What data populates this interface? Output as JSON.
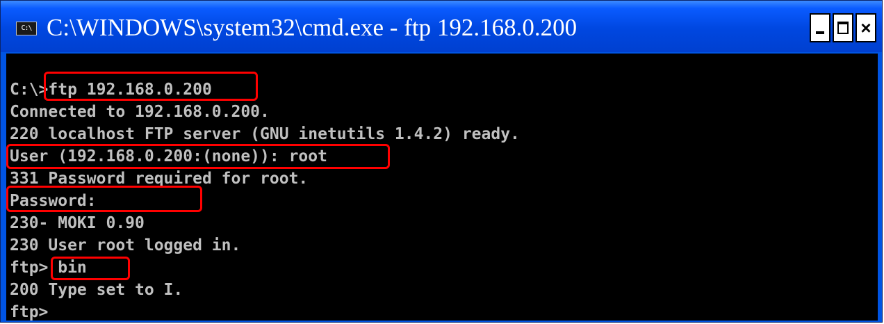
{
  "window": {
    "title": "C:\\WINDOWS\\system32\\cmd.exe - ftp 192.168.0.200",
    "icon": "cmd-console-icon",
    "icon_text": "C:\\",
    "controls": [
      "minimize-icon",
      "maximize-icon",
      "close-icon"
    ],
    "close_label": "×"
  },
  "console": {
    "lines": [
      "C:\\>ftp 192.168.0.200",
      "Connected to 192.168.0.200.",
      "220 localhost FTP server (GNU inetutils 1.4.2) ready.",
      "User (192.168.0.200:(none)): root",
      "331 Password required for root.",
      "Password:",
      "230- MOKI 0.90",
      "230 User root logged in.",
      "ftp> bin",
      "200 Type set to I.",
      "ftp>"
    ],
    "text_color": "#c0c0c0",
    "background": "#000000"
  },
  "highlight_color": "#ff0000"
}
